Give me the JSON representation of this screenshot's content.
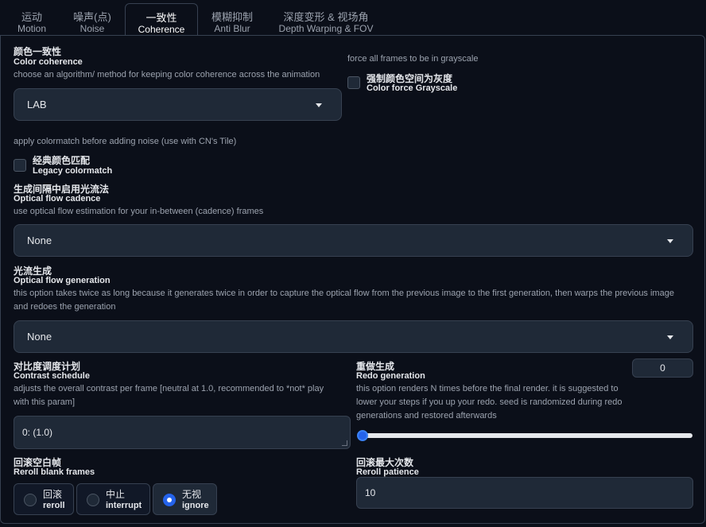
{
  "tabs": [
    {
      "zh": "运动",
      "en": "Motion"
    },
    {
      "zh": "噪声(点)",
      "en": "Noise"
    },
    {
      "zh": "一致性",
      "en": "Coherence"
    },
    {
      "zh": "模糊抑制",
      "en": "Anti Blur"
    },
    {
      "zh": "深度变形 & 视场角",
      "en": "Depth Warping & FOV"
    }
  ],
  "active_tab": "Coherence",
  "color_coherence": {
    "zh": "颜色一致性",
    "en": "Color coherence",
    "info": "choose an algorithm/ method for keeping color coherence across the animation",
    "value": "LAB"
  },
  "color_force_grayscale": {
    "info": "force all frames to be in grayscale",
    "zh": "强制颜色空间为灰度",
    "en": "Color force Grayscale",
    "checked": false
  },
  "legacy_colormatch": {
    "info": "apply colormatch before adding noise (use with CN's Tile)",
    "zh": "经典颜色匹配",
    "en": "Legacy colormatch",
    "checked": false
  },
  "optical_flow_cadence": {
    "zh": "生成间隔中启用光流法",
    "en": "Optical flow cadence",
    "info": "use optical flow estimation for your in-between (cadence) frames",
    "value": "None"
  },
  "optical_flow_generation": {
    "zh": "光流生成",
    "en": "Optical flow generation",
    "info_line1": "this option takes twice as long because it generates twice in order to capture the optical flow from the previous image to the first generation, then warps the previous image",
    "info_line2": "and redoes the generation",
    "value": "None"
  },
  "contrast_schedule": {
    "zh": "对比度调度计划",
    "en": "Contrast schedule",
    "info_line1": "adjusts the overall contrast per frame [neutral at 1.0, recommended to *not* play",
    "info_line2": "with this param]",
    "value": "0: (1.0)"
  },
  "redo_generation": {
    "zh": "重做生成",
    "en": "Redo generation",
    "info_line1": "this option renders N times before the final render. it is suggested to",
    "info_line2": "lower your steps if you up your redo. seed is randomized during redo",
    "info_line3": "generations and restored afterwards",
    "value": "0",
    "slider_fraction": 0
  },
  "reroll_blank_frames": {
    "zh": "回滚空白帧",
    "en": "Reroll blank frames",
    "options": [
      {
        "zh": "回滚",
        "en": "reroll"
      },
      {
        "zh": "中止",
        "en": "interrupt"
      },
      {
        "zh": "无视",
        "en": "ignore"
      }
    ],
    "selected": "ignore"
  },
  "reroll_patience": {
    "zh": "回滚最大次数",
    "en": "Reroll patience",
    "value": "10"
  },
  "colors": {
    "background": "#0b0f19",
    "input_bg": "#1f2937",
    "border": "#374151",
    "accent": "#2563eb",
    "muted_text": "#9ca3af"
  }
}
